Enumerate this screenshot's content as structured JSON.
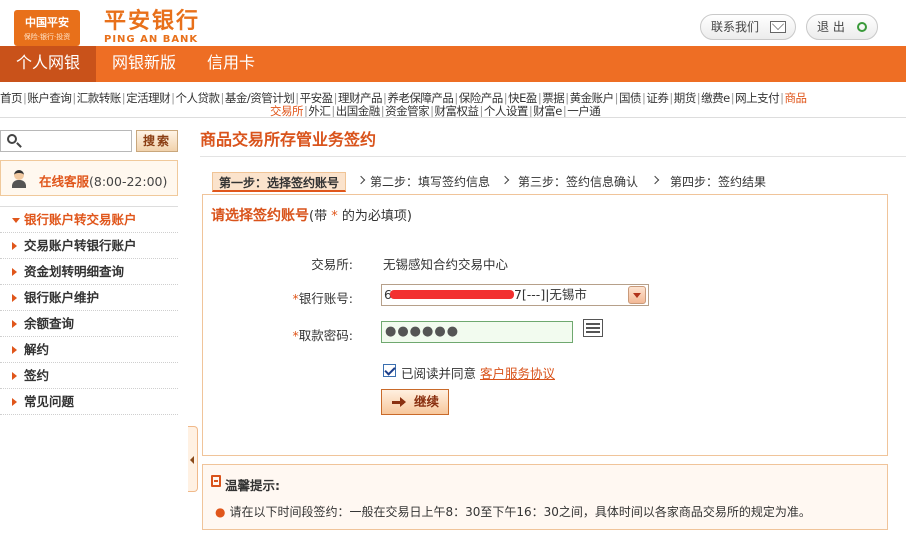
{
  "brand": {
    "logo_line1": "中国平安",
    "logo_line2": "保险·银行·投资",
    "bank_cn": "平安银行",
    "bank_en": "PING AN BANK"
  },
  "header": {
    "contact_label": "联系我们",
    "exit_label": "退 出"
  },
  "mainnav": {
    "tabs": [
      {
        "label": "个人网银"
      },
      {
        "label": "网银新版"
      },
      {
        "label": "信用卡"
      }
    ]
  },
  "subnav": {
    "row1": [
      "首页",
      "账户查询",
      "汇款转账",
      "定活理财",
      "个人贷款",
      "基金/资管计划",
      "平安盈",
      "理财产品",
      "养老保障产品",
      "保险产品",
      "快E盈",
      "票据",
      "黄金账户",
      "国债",
      "证券",
      "期货",
      "缴费e",
      "网上支付",
      "商品"
    ],
    "row2": [
      "交易所",
      "外汇",
      "出国金融",
      "资金管家",
      "财富权益",
      "个人设置",
      "财富e",
      "一户通"
    ]
  },
  "sidebar": {
    "search_button": "搜索",
    "service_label": "在线客服",
    "service_hours": "(8:00-22:00)",
    "menu": [
      {
        "label": "银行账户转交易账户",
        "active": true
      },
      {
        "label": "交易账户转银行账户"
      },
      {
        "label": "资金划转明细查询"
      },
      {
        "label": "银行账户维护"
      },
      {
        "label": "余额查询"
      },
      {
        "label": "解约"
      },
      {
        "label": "签约"
      },
      {
        "label": "常见问题"
      }
    ]
  },
  "content": {
    "title": "商品交易所存管业务签约",
    "steps": [
      "第一步：选择签约账号",
      "第二步：填写签约信息",
      "第三步：签约信息确认",
      "第四步：签约结果"
    ],
    "section_title": "请选择签约账号",
    "section_note_pre": "(带 ",
    "section_note_star": "*",
    "section_note_post": " 的为必填项)",
    "exchange_label": "交易所:",
    "exchange_value": "无锡感知合约交易中心",
    "account_label": "银行账号:",
    "account_prefix": "6",
    "account_suffix": "7[---]|无锡市",
    "password_label": "取款密码:",
    "password_value": "●●●●●●",
    "agree_text": "已阅读并同意",
    "agree_link": "客户服务协议",
    "submit_label": "继续"
  },
  "tips": {
    "title": "温馨提示:",
    "line": "请在以下时间段签约：一般在交易日上午8：30至下午16：30之间，具体时间以各家商品交易所的规定为准。"
  }
}
